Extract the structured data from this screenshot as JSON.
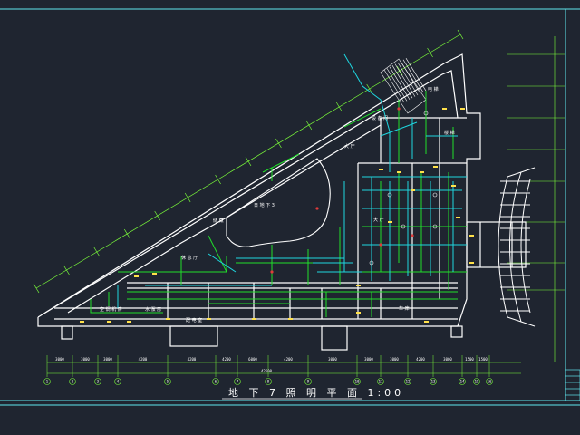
{
  "drawing": {
    "title": "地 下 7 照 明 平 面 1:00",
    "colors": {
      "background": "#1f2530",
      "wall": "#ffffff",
      "lighting_wire": "#21e02a",
      "distribution_wire": "#1fd7e0",
      "axis": "#7cff3a",
      "frame": "#5fe6ee",
      "accent": "#ffe14a",
      "fixture": "#e03b3b"
    },
    "room_labels": [
      "大 厅",
      "休 息 厅",
      "大 厅",
      "楼 梯",
      "电 梯",
      "储 藏",
      "空 调 机 房",
      "水 泵 房",
      "配 电 室",
      "车 库",
      "设 备 间"
    ],
    "atrium_label": "日 地 下 3",
    "axis_bubbles": [
      "1",
      "2",
      "3",
      "4",
      "5",
      "6",
      "7",
      "8",
      "9",
      "10",
      "11",
      "12",
      "13",
      "14",
      "15",
      "16"
    ],
    "dimension_texts": [
      "3000",
      "3000",
      "3000",
      "4200",
      "4200",
      "4200",
      "6000",
      "4200",
      "3000",
      "3000",
      "3000",
      "4200",
      "3000",
      "1500",
      "1500"
    ],
    "total_dimension": "42600",
    "title_block_rows": [
      "",
      "",
      "",
      "",
      ""
    ]
  }
}
